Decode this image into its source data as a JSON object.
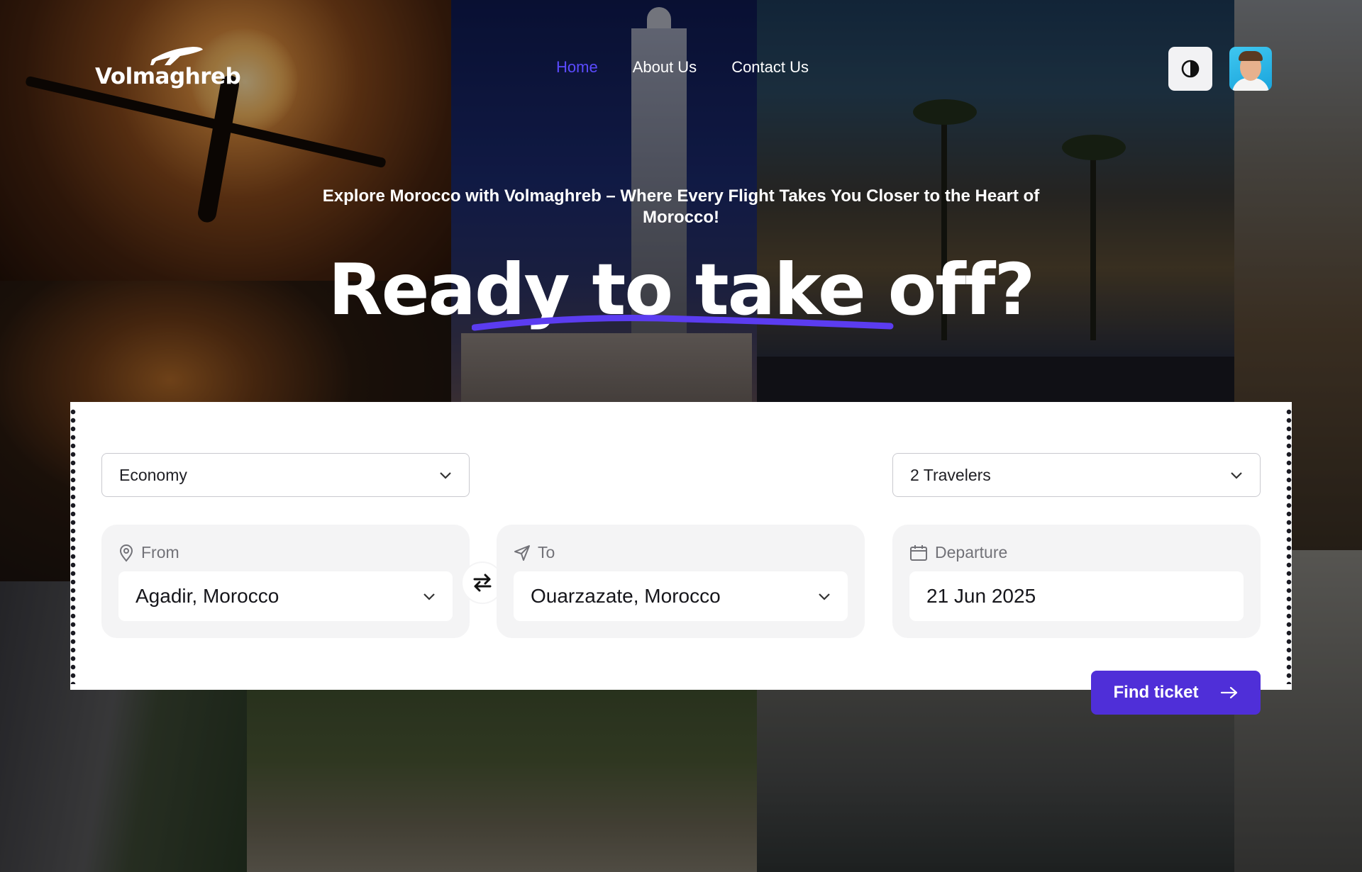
{
  "brand": {
    "logo_text": "Volmaghreb",
    "accent": "#5b4bff",
    "button_color": "#4f2fd8"
  },
  "nav": {
    "items": [
      {
        "label": "Home",
        "active": true
      },
      {
        "label": "About Us",
        "active": false
      },
      {
        "label": "Contact Us",
        "active": false
      }
    ]
  },
  "header": {
    "theme_toggle_icon": "contrast-icon",
    "avatar_icon": "user-avatar"
  },
  "hero": {
    "tagline": "Explore Morocco with Volmaghreb – Where Every Flight Takes You Closer to the Heart of Morocco!",
    "headline": "Ready to take off?"
  },
  "search": {
    "cabin_class": "Economy",
    "travelers": "2 Travelers",
    "from": {
      "label": "From",
      "value": "Agadir, Morocco",
      "icon": "location-pin-icon"
    },
    "to": {
      "label": "To",
      "value": "Ouarzazate, Morocco",
      "icon": "send-icon"
    },
    "departure": {
      "label": "Departure",
      "value": "21 Jun 2025",
      "icon": "calendar-icon"
    },
    "swap_icon": "swap-arrows-icon",
    "submit_label": "Find ticket",
    "submit_icon": "arrow-right-icon"
  }
}
